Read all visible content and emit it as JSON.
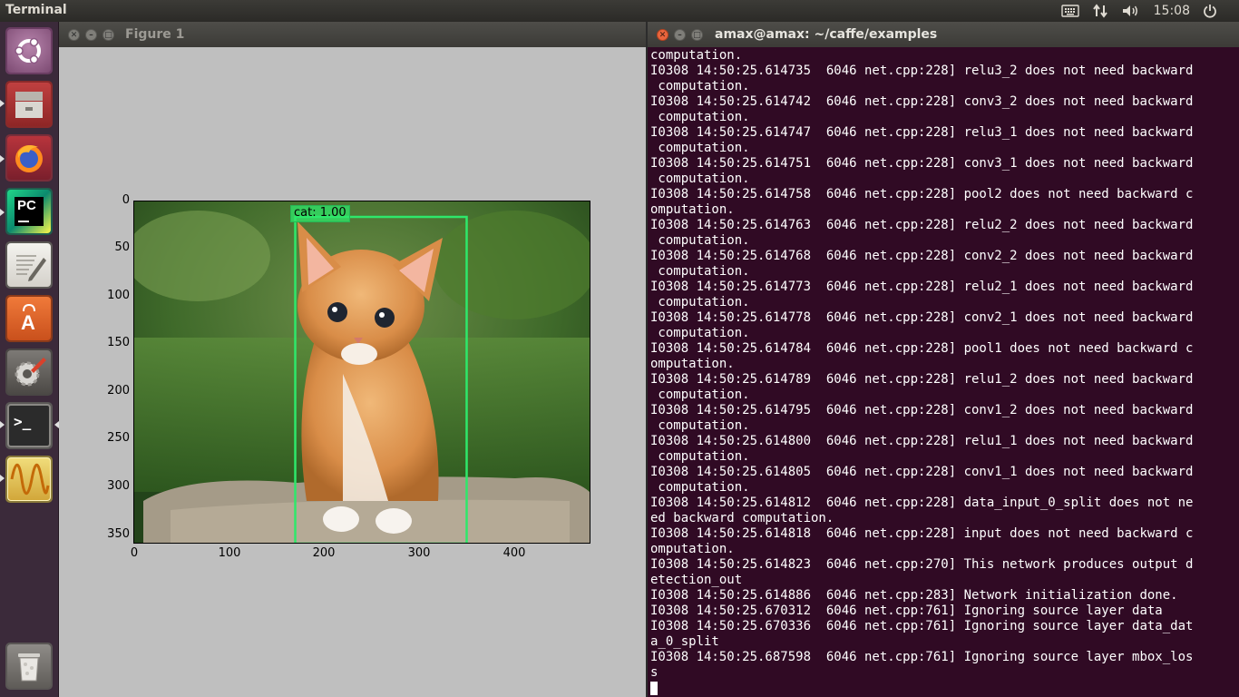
{
  "top_panel": {
    "app_title": "Terminal",
    "clock": "15:08",
    "indicators": [
      "keyboard-icon",
      "network-icon",
      "volume-icon",
      "power-icon"
    ]
  },
  "launcher": {
    "items": [
      {
        "name": "ubuntu-dash",
        "icon": "ubuntu-logo-icon"
      },
      {
        "name": "files",
        "icon": "files-icon"
      },
      {
        "name": "firefox",
        "icon": "firefox-icon"
      },
      {
        "name": "pycharm",
        "icon": "pycharm-icon",
        "label": "PC"
      },
      {
        "name": "text-editor",
        "icon": "text-editor-icon"
      },
      {
        "name": "software-center",
        "icon": "software-center-icon",
        "label": "A"
      },
      {
        "name": "system-settings",
        "icon": "system-settings-icon"
      },
      {
        "name": "terminal",
        "icon": "terminal-icon",
        "label": ">_"
      },
      {
        "name": "figure",
        "icon": "waveform-icon"
      },
      {
        "name": "trash",
        "icon": "trash-icon"
      }
    ]
  },
  "figure": {
    "title": "Figure 1",
    "detection_label": "cat: 1.00",
    "y_ticks": [
      "0",
      "50",
      "100",
      "150",
      "200",
      "250",
      "300",
      "350"
    ],
    "x_ticks": [
      "0",
      "100",
      "200",
      "300",
      "400"
    ],
    "box_color": "#2ee86a"
  },
  "terminal": {
    "title": "amax@amax: ~/caffe/examples",
    "lines": [
      "computation.",
      "I0308 14:50:25.614735  6046 net.cpp:228] relu3_2 does not need backward",
      " computation.",
      "I0308 14:50:25.614742  6046 net.cpp:228] conv3_2 does not need backward",
      " computation.",
      "I0308 14:50:25.614747  6046 net.cpp:228] relu3_1 does not need backward",
      " computation.",
      "I0308 14:50:25.614751  6046 net.cpp:228] conv3_1 does not need backward",
      " computation.",
      "I0308 14:50:25.614758  6046 net.cpp:228] pool2 does not need backward c",
      "omputation.",
      "I0308 14:50:25.614763  6046 net.cpp:228] relu2_2 does not need backward",
      " computation.",
      "I0308 14:50:25.614768  6046 net.cpp:228] conv2_2 does not need backward",
      " computation.",
      "I0308 14:50:25.614773  6046 net.cpp:228] relu2_1 does not need backward",
      " computation.",
      "I0308 14:50:25.614778  6046 net.cpp:228] conv2_1 does not need backward",
      " computation.",
      "I0308 14:50:25.614784  6046 net.cpp:228] pool1 does not need backward c",
      "omputation.",
      "I0308 14:50:25.614789  6046 net.cpp:228] relu1_2 does not need backward",
      " computation.",
      "I0308 14:50:25.614795  6046 net.cpp:228] conv1_2 does not need backward",
      " computation.",
      "I0308 14:50:25.614800  6046 net.cpp:228] relu1_1 does not need backward",
      " computation.",
      "I0308 14:50:25.614805  6046 net.cpp:228] conv1_1 does not need backward",
      " computation.",
      "I0308 14:50:25.614812  6046 net.cpp:228] data_input_0_split does not ne",
      "ed backward computation.",
      "I0308 14:50:25.614818  6046 net.cpp:228] input does not need backward c",
      "omputation.",
      "I0308 14:50:25.614823  6046 net.cpp:270] This network produces output d",
      "etection_out",
      "I0308 14:50:25.614886  6046 net.cpp:283] Network initialization done.",
      "I0308 14:50:25.670312  6046 net.cpp:761] Ignoring source layer data",
      "I0308 14:50:25.670336  6046 net.cpp:761] Ignoring source layer data_dat",
      "a_0_split",
      "I0308 14:50:25.687598  6046 net.cpp:761] Ignoring source layer mbox_los",
      "s"
    ]
  }
}
